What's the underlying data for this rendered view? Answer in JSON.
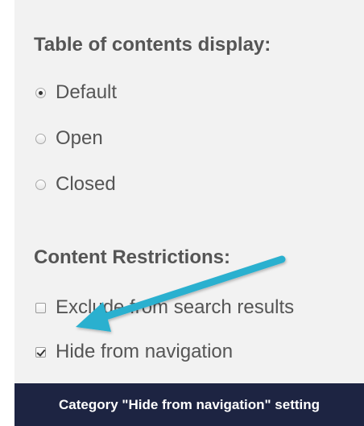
{
  "toc": {
    "heading": "Table of contents display:",
    "options": [
      {
        "label": "Default",
        "selected": true
      },
      {
        "label": "Open",
        "selected": false
      },
      {
        "label": "Closed",
        "selected": false
      }
    ]
  },
  "restrictions": {
    "heading": "Content Restrictions:",
    "options": [
      {
        "label": "Exclude from search results",
        "checked": false
      },
      {
        "label": "Hide from navigation",
        "checked": true
      }
    ]
  },
  "caption": "Category \"Hide from navigation\" setting",
  "colors": {
    "panel_bg": "#f2f2f2",
    "caption_bg": "#1d2442",
    "arrow": "#2bb0cf",
    "text": "#555555"
  },
  "icons": {
    "annotation_arrow": "arrow-icon"
  }
}
